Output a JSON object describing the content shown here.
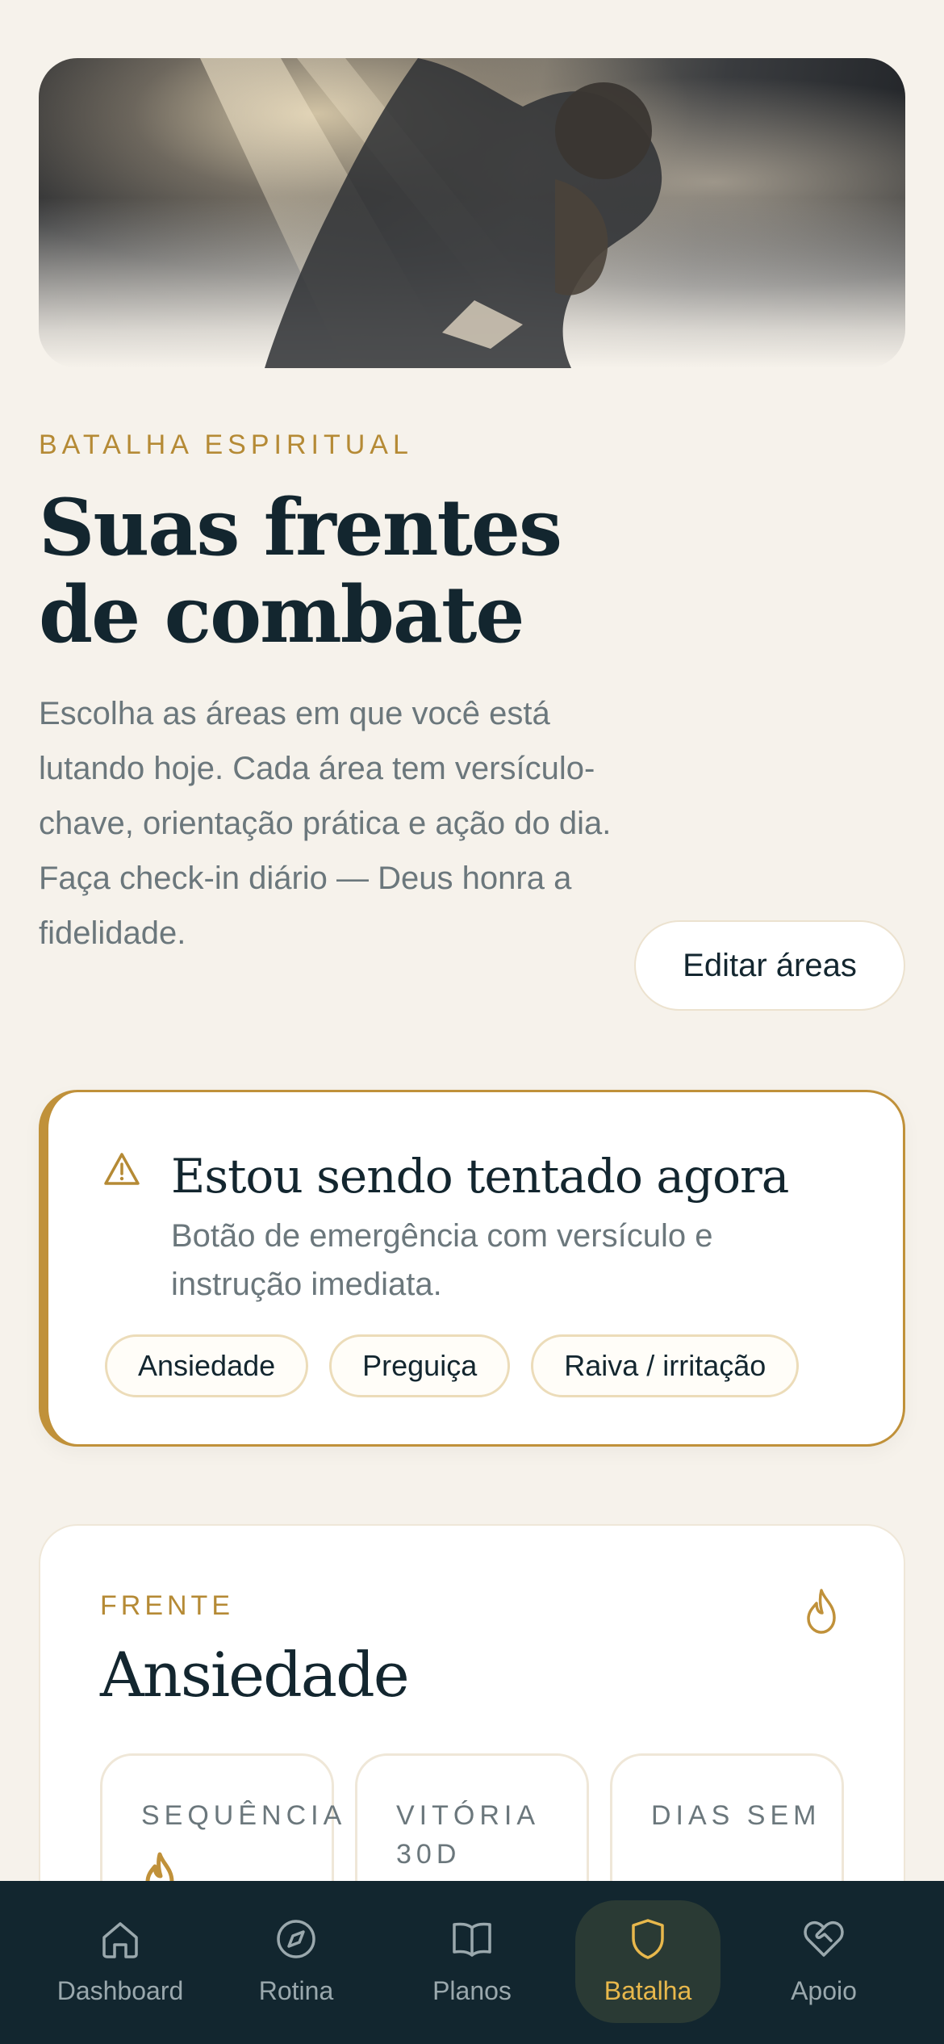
{
  "hero": {
    "image_alt": "Homem orando sob feixes de luz"
  },
  "header": {
    "eyebrow": "BATALHA ESPIRITUAL",
    "title": "Suas frentes de combate",
    "description": "Escolha as áreas em que você está lutando hoje. Cada área tem versículo-chave, orientação prática e ação do dia. Faça check-in diário — Deus honra a fidelidade.",
    "edit_button": "Editar áreas"
  },
  "emergency": {
    "icon": "warning-icon",
    "title": "Estou sendo tentado agora",
    "subtitle": "Botão de emergência com versículo e instrução imediata.",
    "chips": [
      "Ansiedade",
      "Preguiça",
      "Raiva / irritação"
    ]
  },
  "front": {
    "eyebrow": "FRENTE",
    "title": "Ansiedade",
    "icon": "flame-icon",
    "stats": [
      {
        "label": "SEQUÊNCIA"
      },
      {
        "label": "VITÓRIA 30D"
      },
      {
        "label": "DIAS SEM"
      }
    ]
  },
  "nav": {
    "items": [
      {
        "label": "Dashboard",
        "icon": "home-icon",
        "active": false
      },
      {
        "label": "Rotina",
        "icon": "compass-icon",
        "active": false
      },
      {
        "label": "Planos",
        "icon": "book-icon",
        "active": false
      },
      {
        "label": "Batalha",
        "icon": "shield-icon",
        "active": true
      },
      {
        "label": "Apoio",
        "icon": "heart-hands-icon",
        "active": false
      }
    ]
  },
  "colors": {
    "background": "#f6f2eb",
    "accent_gold": "#c0913a",
    "navy": "#12262f",
    "muted_text": "#6b777c"
  }
}
